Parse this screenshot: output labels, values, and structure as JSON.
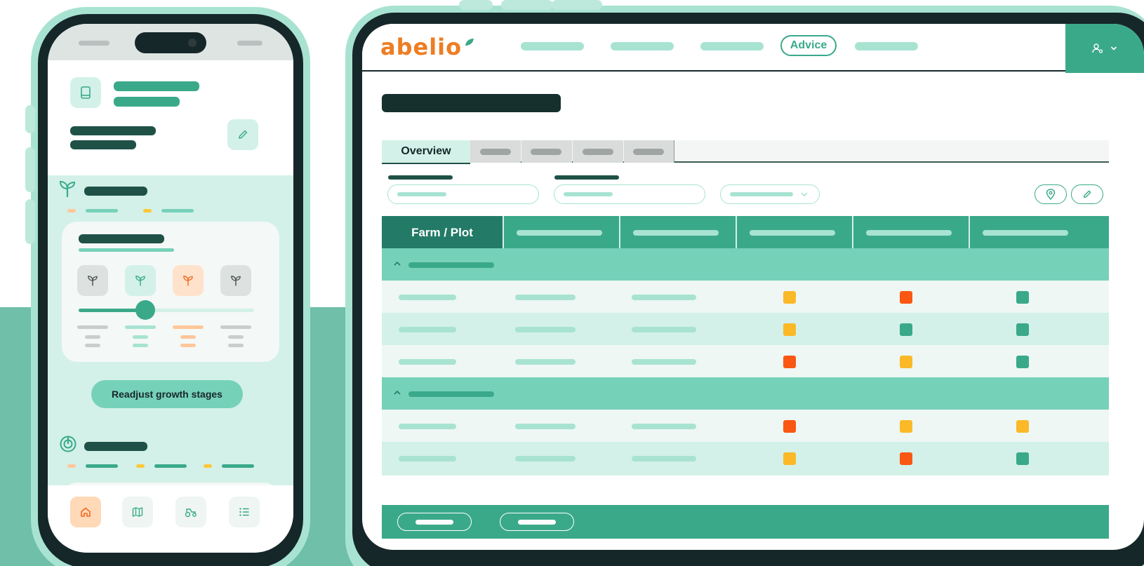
{
  "brand": {
    "logo_text": "abelio",
    "accent": "#3aa98a",
    "accent_dark": "#237b67",
    "logo_color": "#ef7d22"
  },
  "phone": {
    "readjust_button_label": "Readjust growth stages",
    "slider_level_fraction": 0.38,
    "growth_stage_icons": [
      "sprout-icon",
      "sprout-icon",
      "sprout-icon",
      "sprout-icon"
    ],
    "bottom_nav": [
      {
        "icon": "home-icon",
        "active": true
      },
      {
        "icon": "map-icon",
        "active": false
      },
      {
        "icon": "tractor-icon",
        "active": false
      },
      {
        "icon": "list-icon",
        "active": false
      }
    ]
  },
  "tablet": {
    "nav_active_label": "Advice",
    "tabs": {
      "active_label": "Overview"
    },
    "table": {
      "first_column_header": "Farm / Plot",
      "status_colors": {
        "yellow": "#fbb928",
        "red": "#f95712",
        "green": "#3aa98a"
      },
      "groups": [
        {
          "rows": [
            [
              "yellow",
              "red",
              "green"
            ],
            [
              "yellow",
              "green",
              "green"
            ],
            [
              "red",
              "yellow",
              "green"
            ]
          ]
        },
        {
          "rows": [
            [
              "red",
              "yellow",
              "yellow"
            ],
            [
              "yellow",
              "red",
              "green"
            ]
          ]
        }
      ]
    }
  }
}
